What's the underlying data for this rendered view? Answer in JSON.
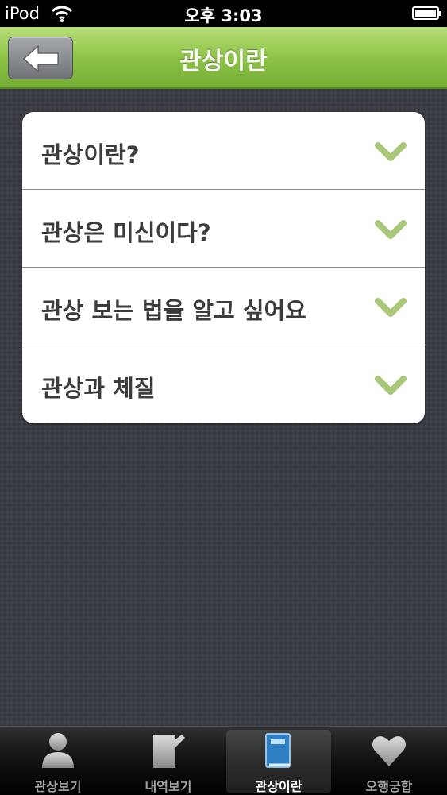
{
  "status_bar": {
    "carrier": "iPod",
    "time": "오후 3:03"
  },
  "nav": {
    "title": "관상이란",
    "back_icon": "back-arrow-icon",
    "accent_color": "#8ec548"
  },
  "list": {
    "items": [
      {
        "label": "관상이란?",
        "icon": "chevron-down-icon"
      },
      {
        "label": "관상은 미신이다?",
        "icon": "chevron-down-icon"
      },
      {
        "label": "관상 보는 법을 알고 싶어요",
        "icon": "chevron-down-icon"
      },
      {
        "label": "관상과 체질",
        "icon": "chevron-down-icon"
      }
    ],
    "chevron_color": "#a9c87a"
  },
  "tabs": [
    {
      "label": "관상보기",
      "icon": "person-icon",
      "active": false
    },
    {
      "label": "내역보기",
      "icon": "notepad-icon",
      "active": false
    },
    {
      "label": "관상이란",
      "icon": "book-icon",
      "active": true
    },
    {
      "label": "오행궁합",
      "icon": "heart-icon",
      "active": false
    }
  ]
}
